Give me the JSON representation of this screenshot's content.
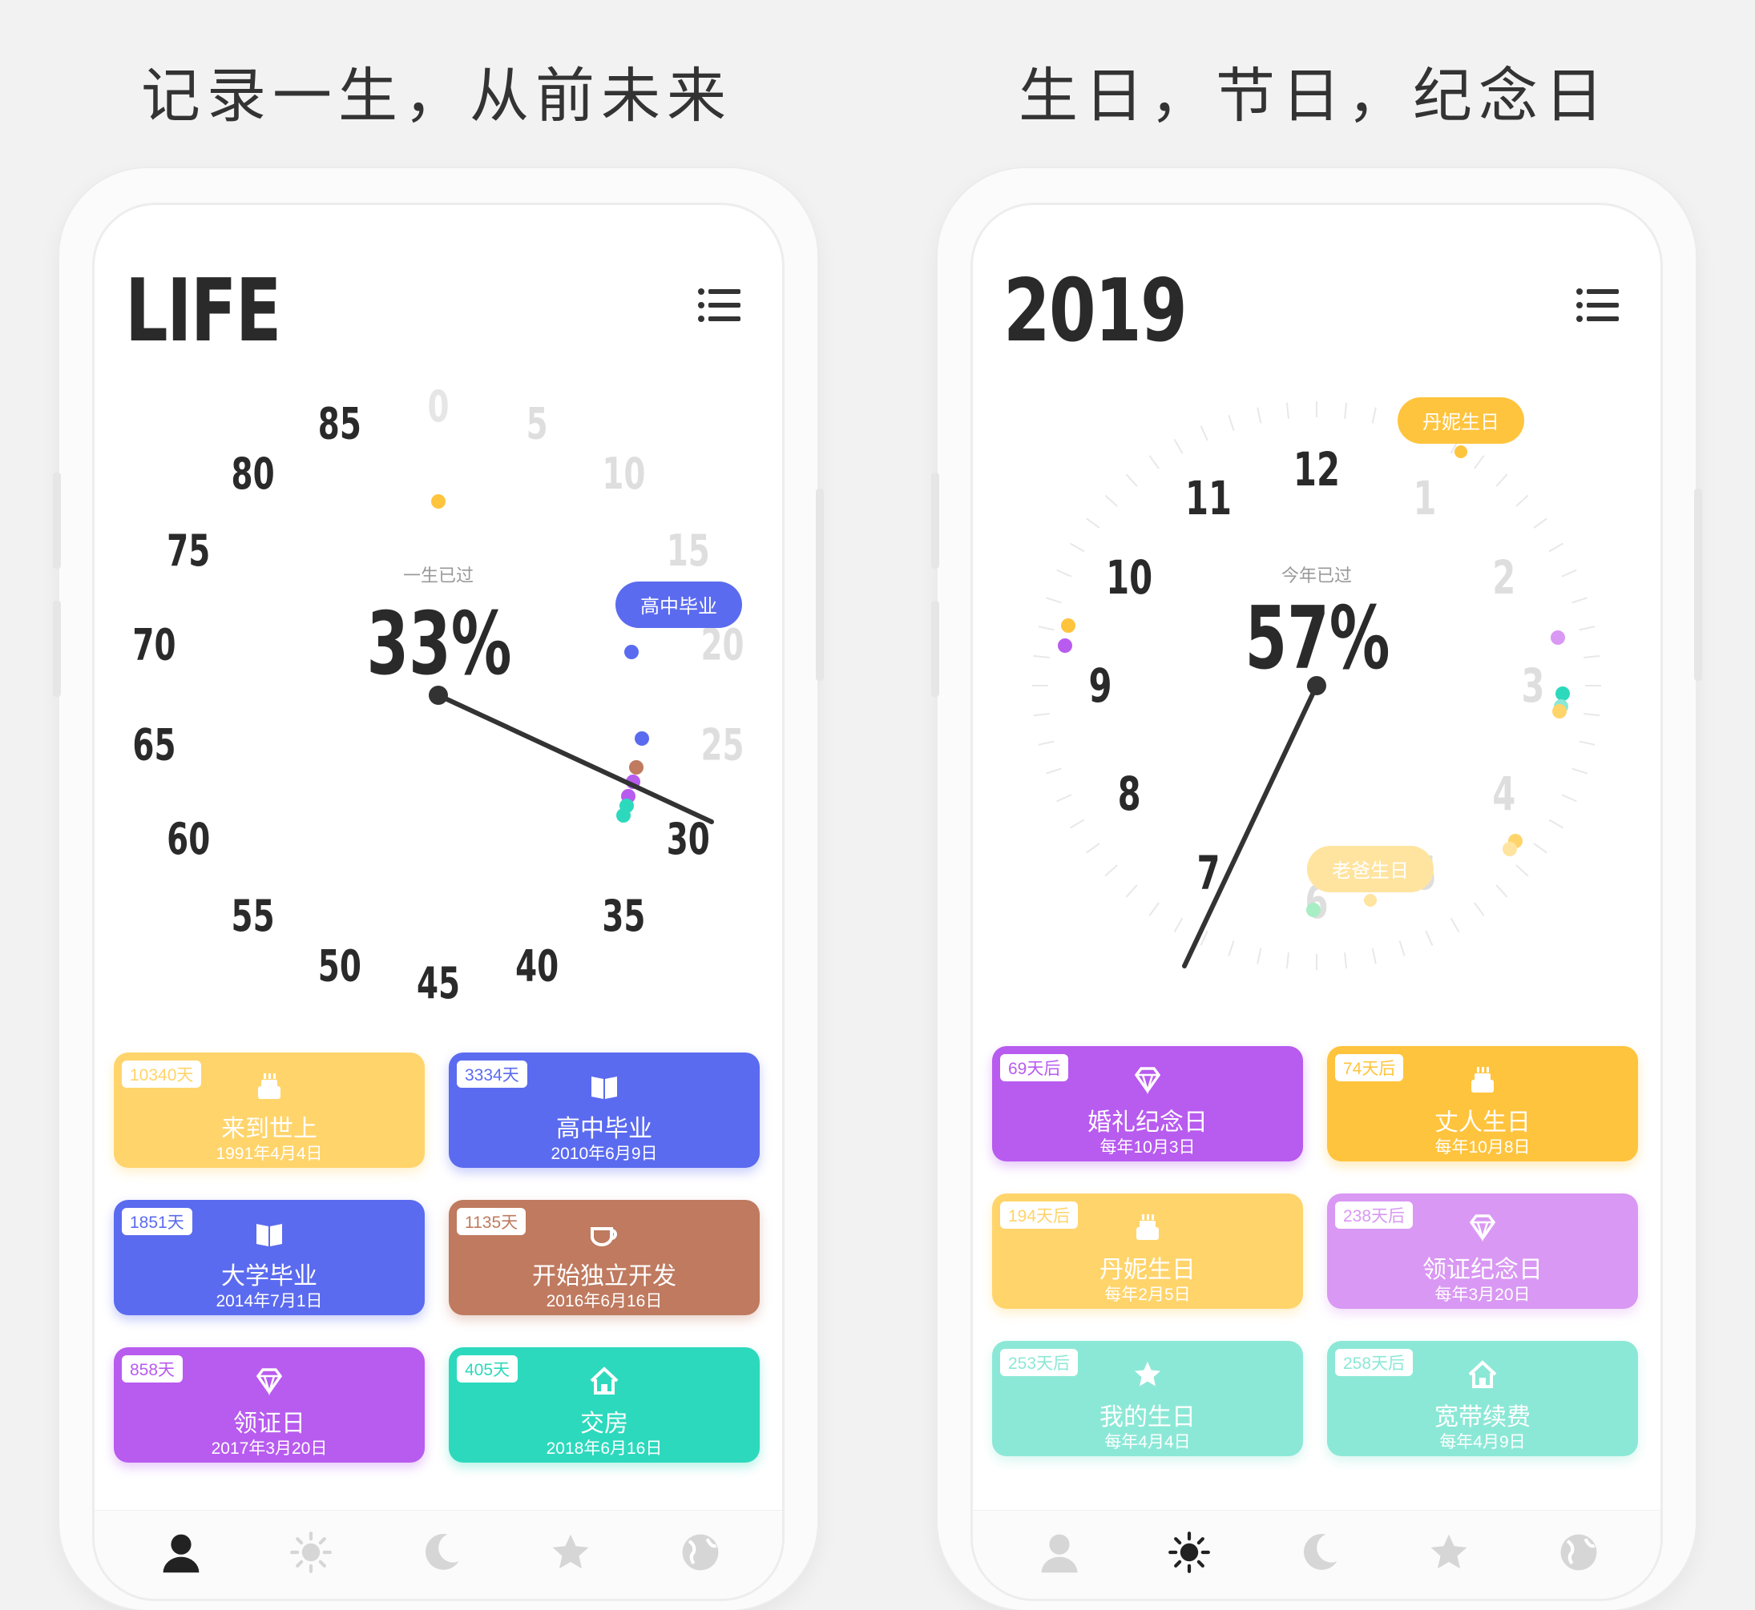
{
  "headlines": {
    "left": "记录一生，从前未来",
    "right": "生日，节日，纪念日"
  },
  "colors": {
    "yellow": "#ffd46b",
    "blue": "#5b6bef",
    "brown": "#bf7a5f",
    "purple": "#b85bef",
    "teal": "#2dd9bd",
    "deep_yellow": "#ffc43d",
    "light_purple": "#d998f3",
    "mint": "#8ce8d6"
  },
  "life_screen": {
    "title": "LIFE",
    "menu_icon": "list-icon",
    "dial": {
      "caption": "一生已过",
      "percent": "33%",
      "labels": [
        "0",
        "5",
        "10",
        "15",
        "20",
        "25",
        "30",
        "35",
        "40",
        "45",
        "50",
        "55",
        "60",
        "65",
        "70",
        "75",
        "80",
        "85"
      ],
      "tooltip": "高中毕业"
    },
    "cards": [
      {
        "badge": "10340天",
        "icon": "cake-icon",
        "name": "来到世上",
        "date": "1991年4月4日",
        "color": "#ffd46b"
      },
      {
        "badge": "3334天",
        "icon": "book-icon",
        "name": "高中毕业",
        "date": "2010年6月9日",
        "color": "#5b6bef"
      },
      {
        "badge": "1851天",
        "icon": "book-icon",
        "name": "大学毕业",
        "date": "2014年7月1日",
        "color": "#5b6bef"
      },
      {
        "badge": "1135天",
        "icon": "coffee-icon",
        "name": "开始独立开发",
        "date": "2016年6月16日",
        "color": "#bf7a5f"
      },
      {
        "badge": "858天",
        "icon": "diamond-icon",
        "name": "领证日",
        "date": "2017年3月20日",
        "color": "#b85bef"
      },
      {
        "badge": "405天",
        "icon": "house-icon",
        "name": "交房",
        "date": "2018年6月16日",
        "color": "#2dd9bd"
      }
    ],
    "tabs": [
      "person-icon",
      "sun-icon",
      "moon-icon",
      "star-icon",
      "globe-icon"
    ],
    "active_tab": 0
  },
  "year_screen": {
    "title": "2019",
    "menu_icon": "list-icon",
    "dial": {
      "caption": "今年已过",
      "percent": "57%",
      "labels": [
        "1",
        "2",
        "3",
        "4",
        "5",
        "6",
        "7",
        "8",
        "9",
        "10",
        "11",
        "12"
      ],
      "tooltip_top": "丹妮生日",
      "tooltip_bottom": "老爸生日"
    },
    "cards": [
      {
        "badge": "69天后",
        "icon": "diamond-icon",
        "name": "婚礼纪念日",
        "date": "每年10月3日",
        "color": "#b85bef"
      },
      {
        "badge": "74天后",
        "icon": "cake-icon",
        "name": "丈人生日",
        "date": "每年10月8日",
        "color": "#ffc43d"
      },
      {
        "badge": "194天后",
        "icon": "cake-icon",
        "name": "丹妮生日",
        "date": "每年2月5日",
        "color": "#ffd46b"
      },
      {
        "badge": "238天后",
        "icon": "diamond-icon",
        "name": "领证纪念日",
        "date": "每年3月20日",
        "color": "#d998f3"
      },
      {
        "badge": "253天后",
        "icon": "star-icon",
        "name": "我的生日",
        "date": "每年4月4日",
        "color": "#8ce8d6"
      },
      {
        "badge": "258天后",
        "icon": "house-icon",
        "name": "宽带续费",
        "date": "每年4月9日",
        "color": "#8ce8d6"
      }
    ],
    "tabs": [
      "person-icon",
      "sun-icon",
      "moon-icon",
      "star-icon",
      "globe-icon"
    ],
    "active_tab": 1
  }
}
